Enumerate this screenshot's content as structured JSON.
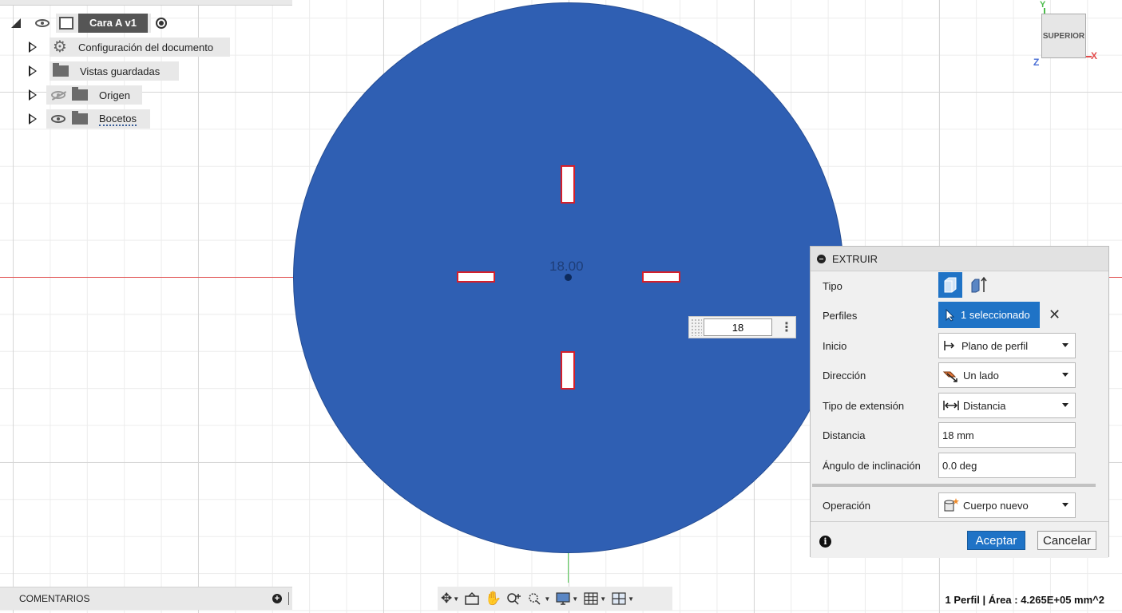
{
  "browser": {
    "root_label": "Cara A v1",
    "items": [
      {
        "label": "Configuración del documento"
      },
      {
        "label": "Vistas guardadas"
      },
      {
        "label": "Origen"
      },
      {
        "label": "Bocetos"
      }
    ]
  },
  "viewcube": {
    "face": "SUPERIOR",
    "x": "X",
    "y": "Y",
    "z": "Z"
  },
  "canvas": {
    "dimension_label": "18.00",
    "input_value": "18"
  },
  "extrude": {
    "title": "EXTRUIR",
    "tipo_label": "Tipo",
    "perfiles_label": "Perfiles",
    "perfiles_value": "1 seleccionado",
    "inicio_label": "Inicio",
    "inicio_value": "Plano de perfil",
    "direccion_label": "Dirección",
    "direccion_value": "Un lado",
    "tipo_ext_label": "Tipo de extensión",
    "tipo_ext_value": "Distancia",
    "distancia_label": "Distancia",
    "distancia_value": "18 mm",
    "angulo_label": "Ángulo de inclinación",
    "angulo_value": "0.0 deg",
    "operacion_label": "Operación",
    "operacion_value": "Cuerpo nuevo",
    "ok_label": "Aceptar",
    "cancel_label": "Cancelar",
    "accent": "#1f73c6"
  },
  "comments": {
    "label": "COMENTARIOS"
  },
  "status": {
    "text": "1 Perfil | Área : 4.265E+05 mm^2"
  },
  "colors": {
    "disk": "#2f5fb3",
    "slot_outline": "#d51f2a",
    "x_axis": "#e25a5a",
    "y_axis": "#5fd35f"
  }
}
